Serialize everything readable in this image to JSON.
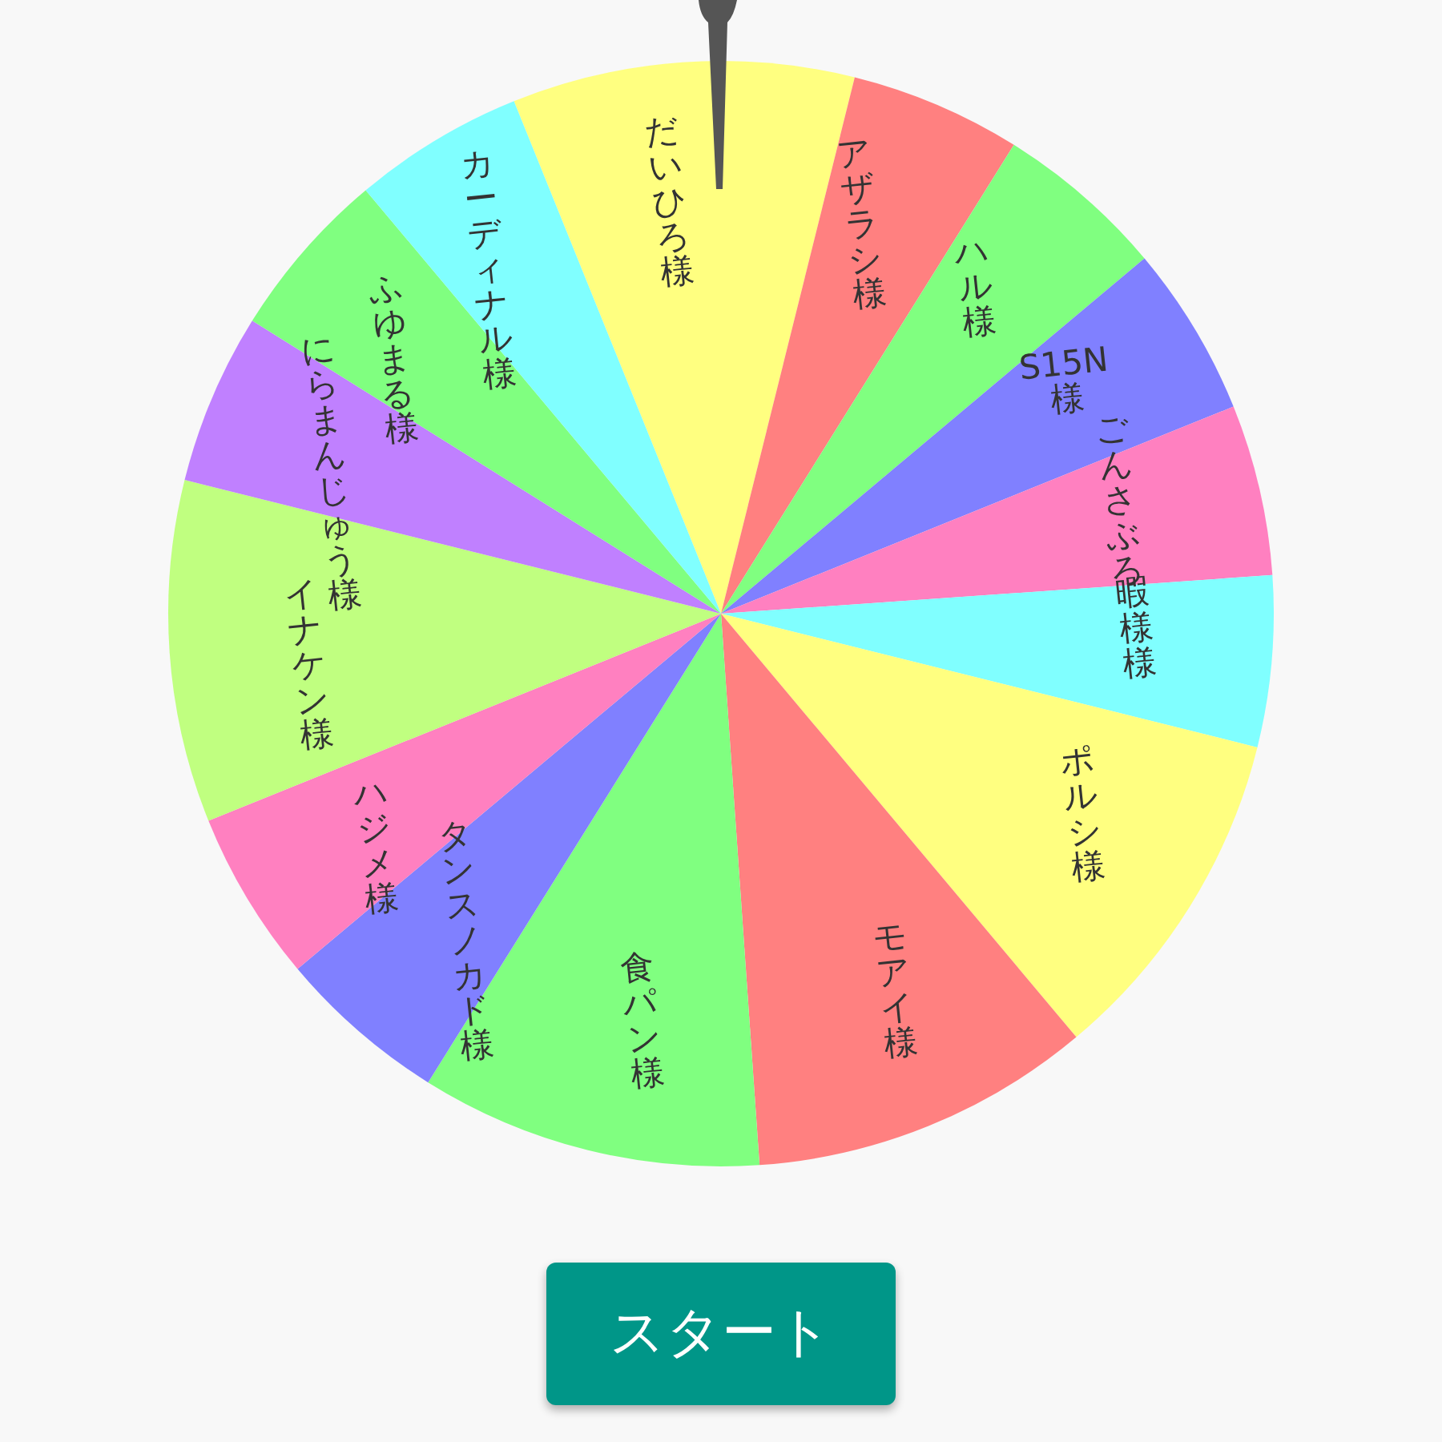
{
  "wheel": {
    "slices": [
      {
        "label": "だいひろ様",
        "color": "#ffff80",
        "kind": "wide"
      },
      {
        "label": "アザラシ様",
        "color": "#ff8080",
        "kind": "narrow"
      },
      {
        "label": "ハル様",
        "color": "#80ff80",
        "kind": "narrow"
      },
      {
        "label": "S15N様",
        "color": "#8080ff",
        "kind": "narrow"
      },
      {
        "label": "ごんさぶろ",
        "color": "#ff80c0",
        "kind": "narrow"
      },
      {
        "label": "暇様様",
        "color": "#80ffff",
        "kind": "narrow"
      },
      {
        "label": "ポルシ様",
        "color": "#ffff80",
        "kind": "wide"
      },
      {
        "label": "モアイ様",
        "color": "#ff8080",
        "kind": "wide"
      },
      {
        "label": "食パン様",
        "color": "#80ff80",
        "kind": "wide"
      },
      {
        "label": "タンスノカド様",
        "color": "#8080ff",
        "kind": "narrow"
      },
      {
        "label": "ハジメ様",
        "color": "#ff80c0",
        "kind": "narrow"
      },
      {
        "label": "イナケン様",
        "color": "#c0ff80",
        "kind": "wide"
      },
      {
        "label": "にらまんじゅう様",
        "color": "#c080ff",
        "kind": "narrow"
      },
      {
        "label": "ふゆまる様",
        "color": "#80ff80",
        "kind": "narrow"
      },
      {
        "label": "カーディナル様",
        "color": "#80ffff",
        "kind": "narrow"
      }
    ]
  },
  "start_button": {
    "label": "スタート"
  }
}
